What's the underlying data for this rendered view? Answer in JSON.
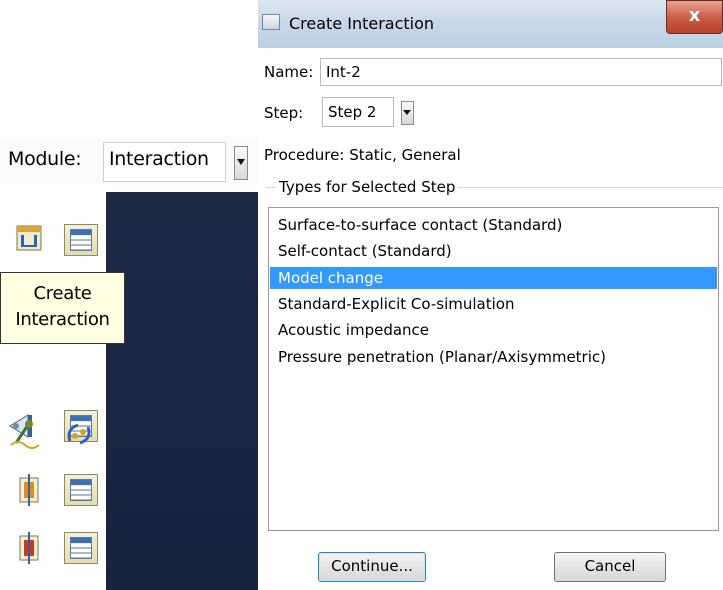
{
  "module_panel": {
    "label": "Module:",
    "selected": "Interaction"
  },
  "toolbox": {
    "tooltip": [
      "Create",
      "Interaction"
    ],
    "tools": [
      {
        "icon": "create-interaction-icon"
      },
      {
        "icon": "interaction-manager-icon"
      },
      {
        "icon": "interaction-property-icon"
      },
      {
        "icon": "interaction-property-manager-icon"
      },
      {
        "icon": "create-constraint-icon"
      },
      {
        "icon": "constraint-manager-icon"
      },
      {
        "icon": "create-connector-icon"
      },
      {
        "icon": "connector-manager-icon"
      },
      {
        "icon": "create-fastener-icon"
      },
      {
        "icon": "fastener-manager-icon"
      },
      {
        "icon": "load-amplitude-icon"
      },
      {
        "icon": "reference-point-icon"
      }
    ]
  },
  "dialog": {
    "title": "Create Interaction",
    "close_label": "x",
    "name_label": "Name:",
    "name_value": "Int-2",
    "step_label": "Step:",
    "step_value": "Step 2",
    "procedure_label": "Procedure:",
    "procedure_value": "Static, General",
    "types_title": "Types for Selected Step",
    "types": [
      "Surface-to-surface contact (Standard)",
      "Self-contact (Standard)",
      "Model change",
      "Standard-Explicit Co-simulation",
      "Acoustic impedance",
      "Pressure penetration (Planar/Axisymmetric)"
    ],
    "selected_type": "Model change",
    "continue_label": "Continue...",
    "cancel_label": "Cancel"
  },
  "colors": {
    "selection": "#3399ff",
    "viewport": "#1e2a44",
    "tooltip_bg": "#ffffe1"
  }
}
